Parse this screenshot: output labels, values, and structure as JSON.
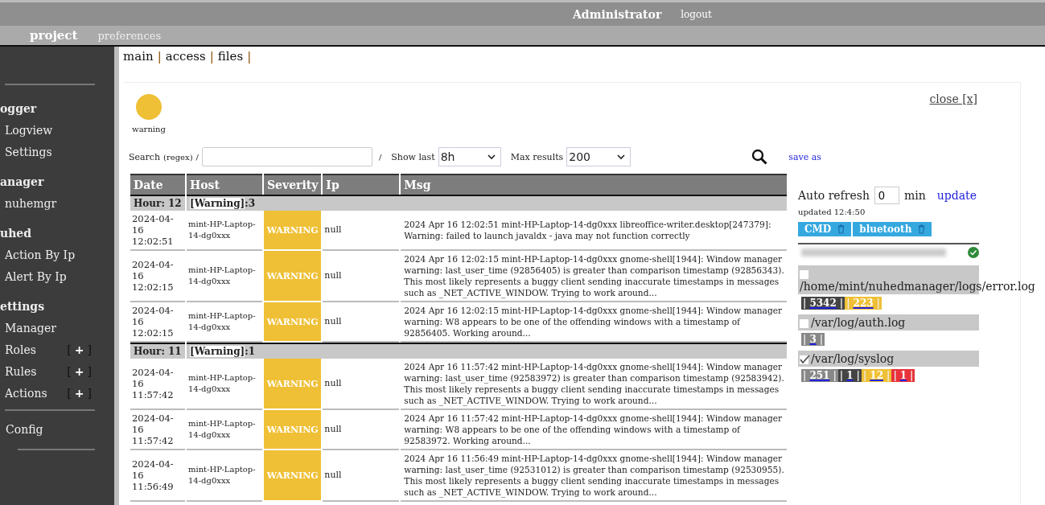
{
  "top_bar": {
    "user": "Administrator",
    "logout": "logout"
  },
  "nav": [
    {
      "label": "project",
      "selected": true
    },
    {
      "label": "preferences",
      "selected": false
    }
  ],
  "sidebar": {
    "sections": [
      {
        "title": "ogger",
        "items": [
          {
            "label": "Logview"
          },
          {
            "label": "Settings"
          }
        ]
      },
      {
        "title": "anager",
        "items": [
          {
            "label": "nuhemgr"
          }
        ]
      },
      {
        "title": "uhed",
        "items": [
          {
            "label": "Action By Ip"
          },
          {
            "label": "Alert  By Ip"
          }
        ]
      },
      {
        "title": "ettings",
        "items": [
          {
            "label": "Manager"
          },
          {
            "label": "Roles",
            "add": [
              "[",
              "+",
              "]"
            ]
          },
          {
            "label": "Rules",
            "add": [
              "[",
              "+",
              "]"
            ]
          },
          {
            "label": "Actions",
            "add": [
              "[",
              "+",
              "]"
            ]
          }
        ]
      }
    ],
    "footer_item": "Config"
  },
  "tabs": [
    {
      "label": "main",
      "separator": "|"
    },
    {
      "label": "access",
      "separator": "|"
    },
    {
      "label": "files",
      "separator": "|"
    }
  ],
  "close": "close [x]",
  "status": {
    "label": "warning",
    "color": "#efc036"
  },
  "filters": {
    "search_label": "Search",
    "search_hint": "(regex)",
    "slash_before": "/",
    "slash_after": "/",
    "show_last_label": "Show last",
    "show_last": "8h",
    "max_results_label": "Max results",
    "max_results": "200",
    "save_as": "save as"
  },
  "table": {
    "columns": [
      "Date",
      "Host",
      "Severity",
      "Ip",
      "Msg"
    ],
    "groups": [
      {
        "hour": "Hour: 12",
        "tag": "[Warning]",
        "count": ":3",
        "rows": [
          {
            "date": "2024-04-16 12:02:51",
            "host": "mint-HP-Laptop-14-dg0xxx",
            "severity": "WARNING",
            "ip": "null",
            "msg": "2024 Apr 16 12:02:51 mint-HP-Laptop-14-dg0xxx libreoffice-writer.desktop[247379]: Warning: failed to launch javaldx - java may not function correctly"
          },
          {
            "date": "2024-04-16 12:02:15",
            "host": "mint-HP-Laptop-14-dg0xxx",
            "severity": "WARNING",
            "ip": "null",
            "msg": "2024 Apr 16 12:02:15 mint-HP-Laptop-14-dg0xxx gnome-shell[1944]: Window manager warning: last_user_time (92856405) is greater than comparison timestamp (92856343). This most likely represents a buggy client sending inaccurate timestamps in messages such as _NET_ACTIVE_WINDOW. Trying to work around..."
          },
          {
            "date": "2024-04-16 12:02:15",
            "host": "mint-HP-Laptop-14-dg0xxx",
            "severity": "WARNING",
            "ip": "null",
            "msg": "2024 Apr 16 12:02:15 mint-HP-Laptop-14-dg0xxx gnome-shell[1944]: Window manager warning: W8 appears to be one of the offending windows with a timestamp of 92856405. Working around..."
          }
        ]
      },
      {
        "hour": "Hour: 11",
        "tag": "[Warning]",
        "count": ":1",
        "rows": [
          {
            "date": "2024-04-16 11:57:42",
            "host": "mint-HP-Laptop-14-dg0xxx",
            "severity": "WARNING",
            "ip": "null",
            "msg": "2024 Apr 16 11:57:42 mint-HP-Laptop-14-dg0xxx gnome-shell[1944]: Window manager warning: last_user_time (92583972) is greater than comparison timestamp (92583942). This most likely represents a buggy client sending inaccurate timestamps in messages such as _NET_ACTIVE_WINDOW. Trying to work around..."
          },
          {
            "date": "2024-04-16 11:57:42",
            "host": "mint-HP-Laptop-14-dg0xxx",
            "severity": "WARNING",
            "ip": "null",
            "msg": "2024 Apr 16 11:57:42 mint-HP-Laptop-14-dg0xxx gnome-shell[1944]: Window manager warning: W8 appears to be one of the offending windows with a timestamp of 92583972. Working around..."
          },
          {
            "date": "2024-04-16 11:56:49",
            "host": "mint-HP-Laptop-14-dg0xxx",
            "severity": "WARNING",
            "ip": "null",
            "msg": "2024 Apr 16 11:56:49 mint-HP-Laptop-14-dg0xxx gnome-shell[1944]: Window manager warning: last_user_time (92531012) is greater than comparison timestamp (92530955). This most likely represents a buggy client sending inaccurate timestamps in messages such as _NET_ACTIVE_WINDOW. Trying to work around..."
          }
        ]
      }
    ]
  },
  "refresh": {
    "label": "Auto refresh",
    "value": "0",
    "unit": "min",
    "update": "update",
    "updated": "updated 12:4:50"
  },
  "tags": [
    {
      "label": "CMD"
    },
    {
      "label": "bluetooth"
    }
  ],
  "host_status": {
    "ok": true
  },
  "files": [
    {
      "path": "/home/mint/nuhedmanager/logs/error.log",
      "checked": false,
      "counts": [
        {
          "left": "|",
          "value": "5342",
          "right": "|",
          "color": "#444444"
        },
        {
          "left": "|",
          "value": "223",
          "right": "|",
          "color": "#efc036"
        }
      ]
    },
    {
      "path": "/var/log/auth.log",
      "checked": false,
      "counts": [
        {
          "left": "|",
          "value": "3",
          "right": "|",
          "color": "#888888"
        }
      ]
    },
    {
      "path": "/var/log/syslog",
      "checked": true,
      "counts": [
        {
          "left": "|",
          "value": "251",
          "right": "|",
          "color": "#888888"
        },
        {
          "left": "|",
          "value": "1",
          "right": "|",
          "color": "#444444"
        },
        {
          "left": "|",
          "value": "12",
          "right": "|",
          "color": "#efc036"
        },
        {
          "left": "|",
          "value": "1",
          "right": "|",
          "color": "#e8333a"
        }
      ]
    }
  ]
}
